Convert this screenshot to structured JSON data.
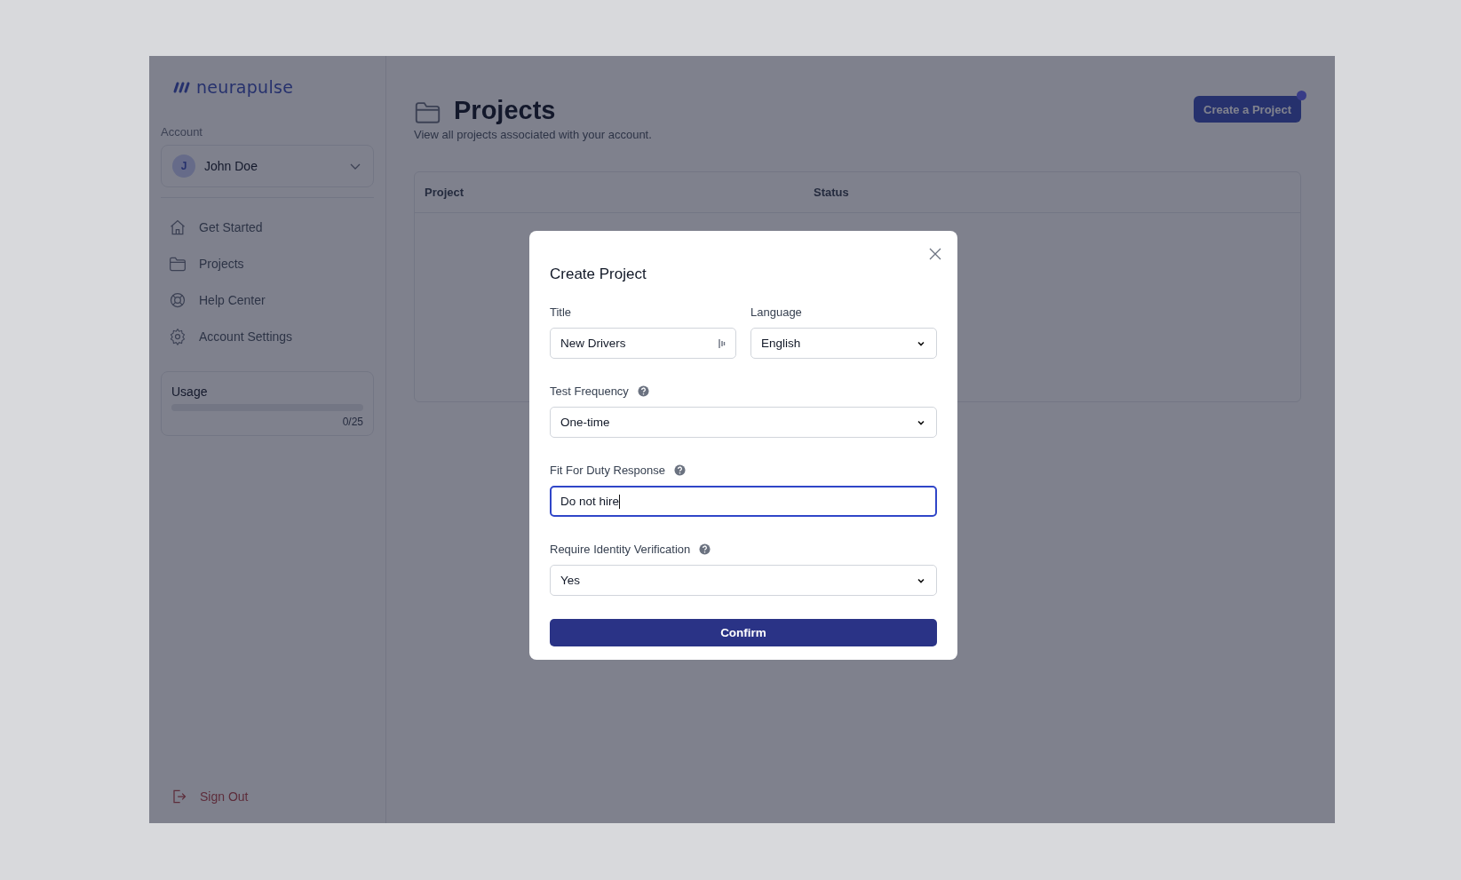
{
  "sidebar": {
    "logo": "neurapulse",
    "account_label": "Account",
    "account": {
      "initial": "J",
      "name": "John Doe"
    },
    "nav": [
      {
        "label": "Get Started",
        "selected": false
      },
      {
        "label": "Projects",
        "selected": false
      },
      {
        "label": "Help Center",
        "selected": false
      },
      {
        "label": "Account Settings",
        "selected": false
      }
    ],
    "usage": {
      "label": "Usage",
      "level": 0,
      "reading": "0/25"
    },
    "sign_out": "Sign Out"
  },
  "main": {
    "title": "Projects",
    "subtitle": "View all projects associated with your account.",
    "create_button": "Create a Project",
    "table": {
      "columns": [
        "Project",
        "Status"
      ]
    }
  },
  "modal": {
    "title": "Create Project",
    "confirm": "Confirm",
    "rows": [
      [
        {
          "label": "Title",
          "kind": "text",
          "value": "New Drivers",
          "help": false,
          "focused": false
        },
        {
          "label": "Language",
          "kind": "select",
          "value": "English",
          "help": false,
          "focused": false
        }
      ],
      [
        {
          "label": "Test Frequency",
          "kind": "select",
          "value": "One-time",
          "help": true,
          "focused": false
        }
      ],
      [
        {
          "label": "Fit For Duty Response",
          "kind": "text",
          "value": "Do not hire",
          "help": true,
          "focused": true
        }
      ],
      [
        {
          "label": "Require Identity Verification",
          "kind": "select",
          "value": "Yes",
          "help": true,
          "focused": false
        }
      ]
    ]
  }
}
